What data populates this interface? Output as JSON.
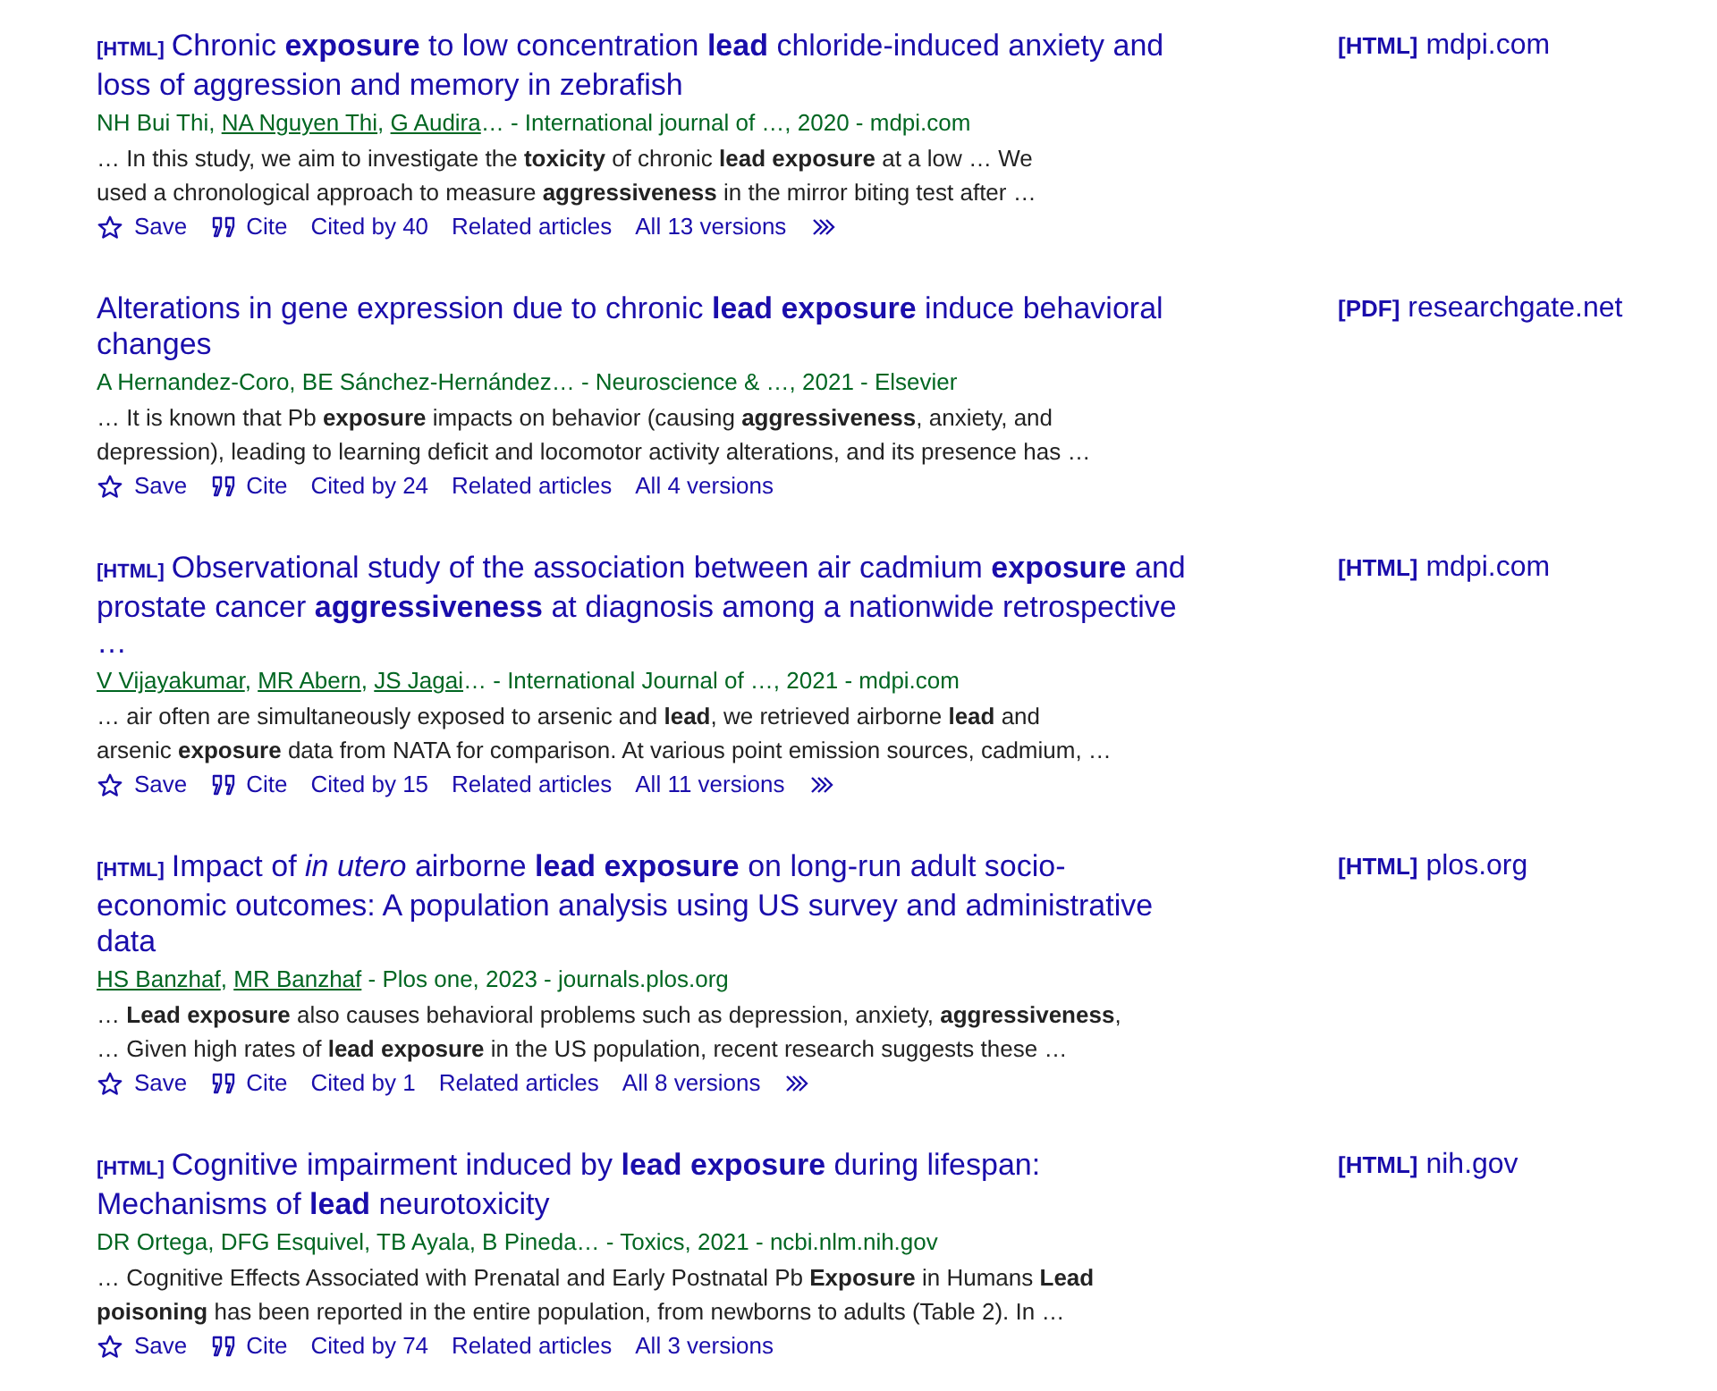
{
  "results": [
    {
      "format": "[HTML]",
      "title": "Chronic **exposure** to low concentration **lead** chloride-induced anxiety and loss of aggression and memory in zebrafish",
      "authors": [
        {
          "text": "NH Bui Thi, ",
          "linked": false
        },
        {
          "text": "NA Nguyen Thi",
          "linked": true,
          "separator": ", "
        },
        {
          "text": "G Audira",
          "linked": true
        },
        {
          "text": "… - International journal of …, 2020 - mdpi.com",
          "linked": false
        }
      ],
      "snippet_lines": [
        "… In this study, we aim to investigate the **toxicity** of chronic **lead exposure** at a low … We",
        "used a chronological approach to measure **aggressiveness** in the mirror biting test after …"
      ],
      "actions": {
        "save": "Save",
        "cite": "Cite",
        "cited_by": "Cited by 40",
        "related": "Related articles",
        "versions": "All 13 versions"
      },
      "more_button": true,
      "side": {
        "format": "[HTML]",
        "domain": "mdpi.com"
      }
    },
    {
      "title": "Alterations in gene expression due to chronic **lead exposure** induce behavioral changes",
      "authors": [
        {
          "text": "A Hernandez-Coro, BE Sánchez-Hernández… - Neuroscience & …, 2021 - Elsevier",
          "linked": false
        }
      ],
      "snippet_lines": [
        "… It is known that Pb **exposure** impacts on behavior (causing **aggressiveness**, anxiety, and",
        "depression), leading to learning deficit and locomotor activity alterations, and its presence has …"
      ],
      "actions": {
        "save": "Save",
        "cite": "Cite",
        "cited_by": "Cited by 24",
        "related": "Related articles",
        "versions": "All 4 versions"
      },
      "more_button": false,
      "side": {
        "format": "[PDF]",
        "domain": "researchgate.net"
      }
    },
    {
      "format": "[HTML]",
      "title": "Observational study of the association between air cadmium **exposure** and prostate cancer **aggressiveness** at diagnosis among a nationwide retrospective …",
      "authors": [
        {
          "text": "V Vijayakumar",
          "linked": true,
          "separator": ", "
        },
        {
          "text": "MR Abern",
          "linked": true,
          "separator": ", "
        },
        {
          "text": "JS Jagai",
          "linked": true
        },
        {
          "text": "… - International Journal of …, 2021 - mdpi.com",
          "linked": false
        }
      ],
      "snippet_lines": [
        "… air often are simultaneously exposed to arsenic and **lead**, we retrieved airborne **lead** and",
        "arsenic **exposure** data from NATA for comparison. At various point emission sources, cadmium, …"
      ],
      "actions": {
        "save": "Save",
        "cite": "Cite",
        "cited_by": "Cited by 15",
        "related": "Related articles",
        "versions": "All 11 versions"
      },
      "more_button": true,
      "side": {
        "format": "[HTML]",
        "domain": "mdpi.com"
      }
    },
    {
      "format": "[HTML]",
      "title": "Impact of *in utero* airborne **lead exposure** on long-run adult socio-economic outcomes: A population analysis using US survey and administrative data",
      "authors": [
        {
          "text": "HS Banzhaf",
          "linked": true,
          "separator": ", "
        },
        {
          "text": "MR Banzhaf",
          "linked": true
        },
        {
          "text": " - Plos one, 2023 - journals.plos.org",
          "linked": false
        }
      ],
      "snippet_lines": [
        "… **Lead exposure** also causes behavioral problems such as depression, anxiety, **aggressiveness**,",
        "… Given high rates of **lead exposure** in the US population, recent research suggests these …"
      ],
      "actions": {
        "save": "Save",
        "cite": "Cite",
        "cited_by": "Cited by 1",
        "related": "Related articles",
        "versions": "All 8 versions"
      },
      "more_button": true,
      "side": {
        "format": "[HTML]",
        "domain": "plos.org"
      }
    },
    {
      "format": "[HTML]",
      "title": "Cognitive impairment induced by **lead exposure** during lifespan: Mechanisms of **lead** neurotoxicity",
      "authors": [
        {
          "text": "DR Ortega, DFG Esquivel, TB Ayala, B Pineda… - Toxics, 2021 - ncbi.nlm.nih.gov",
          "linked": false
        }
      ],
      "snippet_lines": [
        "… Cognitive Effects Associated with Prenatal and Early Postnatal Pb **Exposure** in Humans **Lead**",
        "**poisoning** has been reported in the entire population, from newborns to adults (Table 2). In …"
      ],
      "actions": {
        "save": "Save",
        "cite": "Cite",
        "cited_by": "Cited by 74",
        "related": "Related articles",
        "versions": "All 3 versions"
      },
      "more_button": false,
      "side": {
        "format": "[HTML]",
        "domain": "nih.gov"
      }
    }
  ]
}
